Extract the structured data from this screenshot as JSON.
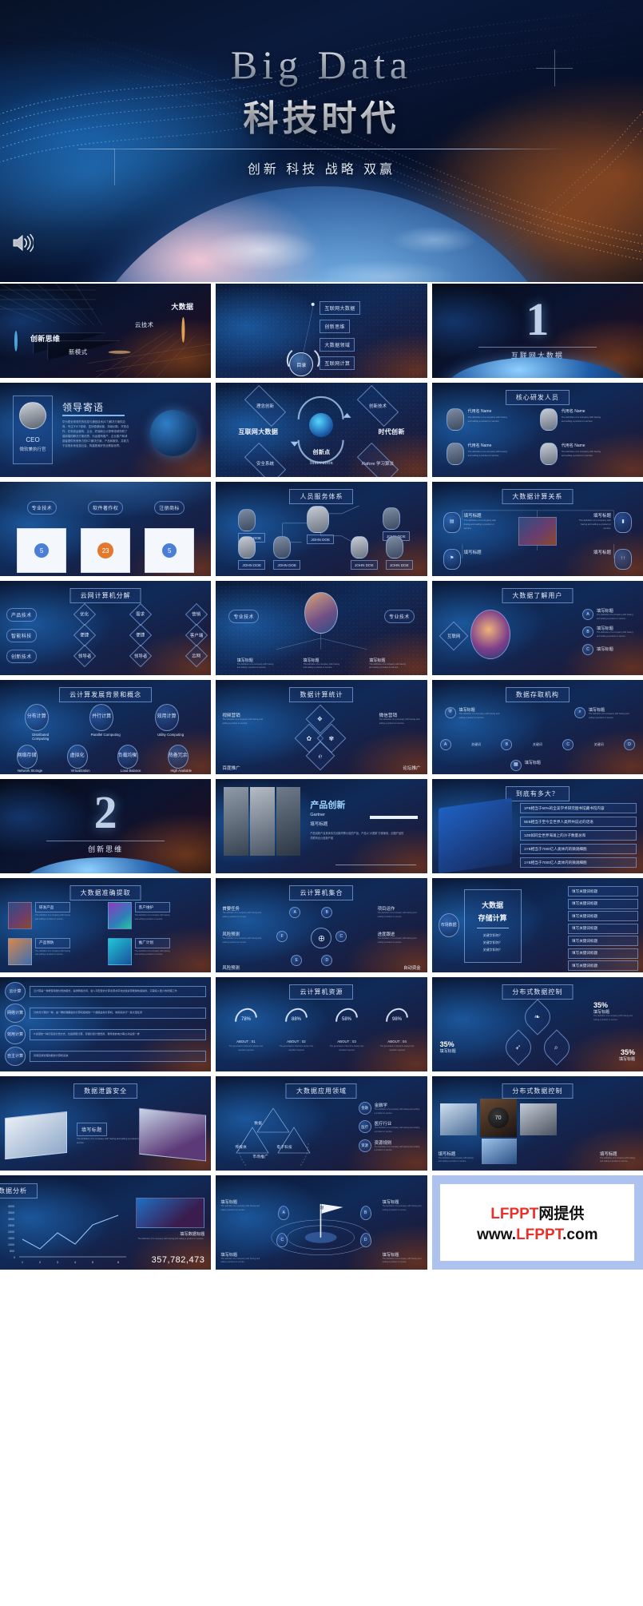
{
  "hero": {
    "title_en": "Big Data",
    "title_cn": "科技时代",
    "subtitle": "创新  科技  战略  双赢",
    "speaker_icon": "speaker-icon"
  },
  "watermark": {
    "line1_red": "LFPPT",
    "line1_black": "网提供",
    "line2_black": "www.",
    "line2_red": "LFPPT",
    "line2_black_end": ".com"
  },
  "slides": [
    {
      "id": 1,
      "name": "intro-keywords",
      "style": "dark",
      "title": "",
      "labels": [
        "大数据",
        "云技术",
        "创新思维",
        "新模式"
      ]
    },
    {
      "id": 2,
      "name": "table-of-contents",
      "style": "blue",
      "title": "",
      "center_label": "目录",
      "chips": [
        "互联网大数据",
        "创新思维",
        "大数据领域",
        "互联网计算"
      ]
    },
    {
      "id": 3,
      "name": "section-one-cover",
      "style": "dark",
      "title": "",
      "number": "1",
      "number_label": "互联网大数据"
    },
    {
      "id": 4,
      "name": "leader-message",
      "style": "blue",
      "title": "",
      "heading": "领导寄语",
      "role": "CEO",
      "role_sub": "微软兼执行官",
      "paragraph": "华为是全球领先的信息与通信技术(ICT)解决方案供应商，专注于ICT领域，坚持稳健经营、持续创新、开放合作，在电信运营商、企业、终端和云计算等领域构筑了端到端的解决方案优势，为运营商客户、企业客户和消费者提供有竞争力的ICT解决方案、产品和服务，并致力于实现未来信息社会、构建更美好的全联接世界。"
    },
    {
      "id": 5,
      "name": "innovation-loop",
      "style": "blue",
      "title": "",
      "center_big": "创新点",
      "center_sub": "Innovation",
      "nodes": [
        "理念创新",
        "创新技术",
        "互联网大数据",
        "时代创新",
        "安全系统",
        "Rafore 学习算法"
      ]
    },
    {
      "id": 6,
      "name": "core-rd-team",
      "style": "blue",
      "title": "核心研发人员",
      "members": [
        {
          "name": "代用名 Name",
          "desc": "The definition of a company with having and selling a product or service."
        },
        {
          "name": "代用名 Name",
          "desc": "The definition of a company with having and selling a product or service."
        },
        {
          "name": "代用名 Name",
          "desc": "The definition of a company with having and selling a product or service."
        },
        {
          "name": "代用名 Name",
          "desc": "The definition of a company with having and selling a product or service."
        }
      ]
    },
    {
      "id": 7,
      "name": "certificates",
      "style": "blue",
      "title": "",
      "clouds": [
        "专业技术",
        "软件著作权",
        "注册商标"
      ],
      "badges": [
        "5",
        "23",
        "5"
      ]
    },
    {
      "id": 8,
      "name": "personnel-service-system",
      "style": "blue",
      "title": "人员服务体系",
      "tags": [
        "JOHN DOE",
        "JOHN DOE",
        "JOHN DOE",
        "JOHN DOE",
        "JOHN DOE",
        "JOHN DOE",
        "JOHN DOE",
        "JOHN DOE"
      ]
    },
    {
      "id": 9,
      "name": "bigdata-compute-relation",
      "style": "blue",
      "title": "大数据计算关系",
      "items": [
        {
          "label": "填写标题",
          "desc": "The definition of a company with having and selling a product or service."
        },
        {
          "label": "填写标题",
          "desc": "The definition of a company with having and selling a product or service."
        },
        {
          "label": "填写标题",
          "desc": "The definition of a company with having and selling a product or service."
        },
        {
          "label": "填写标题",
          "desc": "The definition of a company with having and selling a product or service."
        }
      ]
    },
    {
      "id": 10,
      "name": "cloud-computer-decompose",
      "style": "blue",
      "title": "云网计算机分解",
      "rows": [
        [
          "产品技术",
          "优化",
          "需求",
          "营销"
        ],
        [
          "智能科技",
          "便捷",
          "便捷",
          "客户端"
        ],
        [
          "创新技术",
          "领导者",
          "领导者",
          "云网"
        ]
      ]
    },
    {
      "id": 11,
      "name": "professional-skills",
      "style": "blue",
      "title": "",
      "clouds": [
        "专业技术",
        "专业技术"
      ],
      "captions": [
        "填写标题",
        "填写标题",
        "填写标题"
      ],
      "desc": "The definition of a company with having and selling a product or service."
    },
    {
      "id": 12,
      "name": "bigdata-understand-user",
      "style": "blue",
      "title": "大数据了解用户",
      "left_label": "互联网",
      "items": [
        {
          "key": "A",
          "label": "填写标题",
          "desc": "The definition of a company with having and selling a product or service."
        },
        {
          "key": "B",
          "label": "填写标题",
          "desc": "The definition of a company with having and selling a product or service."
        },
        {
          "key": "C",
          "label": "填写标题",
          "desc": "The definition of a company with having and selling a product or service."
        }
      ]
    },
    {
      "id": 13,
      "name": "cloud-computing-background",
      "style": "blue",
      "title": "云计算发展背景和概念",
      "row1_cn": [
        "分布计算",
        "并行计算",
        "效用计算"
      ],
      "row1_en": [
        "Distributed Computing",
        "Parallel Computing",
        "Utility Computing"
      ],
      "row2_cn": [
        "网络存储",
        "虚拟化",
        "负载均衡",
        "热备冗余"
      ],
      "row2_en": [
        "Network Storage",
        "Virtualization",
        "Load Balance",
        "High Available"
      ]
    },
    {
      "id": 14,
      "name": "data-compute-statistics",
      "style": "blue",
      "title": "数据计算统计",
      "labels": [
        "视频营销",
        "微信营销",
        "百度推广",
        "论坛推广"
      ],
      "desc": "The definition of a company with having and selling a product or service."
    },
    {
      "id": 15,
      "name": "data-access-organization",
      "style": "blue",
      "title": "数据存取机构",
      "steps": [
        "A",
        "B",
        "C",
        "D"
      ],
      "connectors": [
        "关键词",
        "关键词",
        "关键词"
      ],
      "items": [
        {
          "label": "填写标题",
          "desc": "The definition of a company with having and selling a product or service."
        },
        {
          "label": "填写标题",
          "desc": "The definition of a company with having and selling a product or service."
        },
        {
          "label": "填写标题",
          "desc": "The definition of a company with having and selling a product or service."
        }
      ]
    },
    {
      "id": 16,
      "name": "section-two-cover",
      "style": "dark",
      "title": "",
      "number": "2",
      "number_label": "创新思维"
    },
    {
      "id": 17,
      "name": "product-innovation",
      "style": "blue",
      "title": "",
      "heading": "产品创新",
      "sub1": "Gartner",
      "sub2": "填写标题",
      "paragraph": "产品创新户及其体系式创新同等价值的产品，产品以\"大更新\"方便使用，创造产品的关联商业价值新产链"
    },
    {
      "id": 18,
      "name": "how-big-is-it",
      "style": "blue",
      "title": "到底有多大？",
      "facts": [
        "1PB相当于50%的全美学术研究图书馆藏书馆内容",
        "5EB相当于至今全世界人类所共说过的话语",
        "1ZB如同全世界海滩上的沙子数量总和",
        "1YB相当于7000亿人类体内的微观细胞",
        "1YB相当于7000亿人类体内的微观细胞"
      ]
    },
    {
      "id": 19,
      "name": "bigdata-accurate-extract",
      "style": "blue",
      "title": "大数据准确提取",
      "cards": [
        {
          "label": "研发产品",
          "desc": "The definition of a company with having and selling a product or service."
        },
        {
          "label": "客户维护",
          "desc": "The definition of a company with having and selling a product or service."
        },
        {
          "label": "产品预防",
          "desc": "The definition of a company with having and selling a product or service."
        },
        {
          "label": "推广计划",
          "desc": "The definition of a company with having and selling a product or service."
        }
      ]
    },
    {
      "id": 20,
      "name": "cloud-computer-aggregation",
      "style": "blue",
      "title": "云计算机集合",
      "keys": [
        "A",
        "B",
        "F",
        "C",
        "E",
        "D"
      ],
      "labels": [
        "首要任务",
        "项目运作",
        "风险预测",
        "进度跟进",
        "风险预测",
        "自动资金"
      ],
      "desc": "The definition of a company with having and selling a product or service."
    },
    {
      "id": 21,
      "name": "bigdata-storage-compute",
      "style": "blue",
      "title": "",
      "center_l1": "大数据",
      "center_l2": "存储计算",
      "left_label": "市场数据",
      "questions": [
        "关键字如何？",
        "关键字如何？",
        "关键字如何？"
      ],
      "bullets": [
        "填写关键词标题",
        "填写关键词标题",
        "填写关键词标题",
        "填写关键词标题",
        "填写关键词标题",
        "填写关键词标题",
        "填写关键词标题"
      ]
    },
    {
      "id": 22,
      "name": "computing-types-list",
      "style": "blue",
      "title": "",
      "items": [
        {
          "label": "云计算",
          "desc": "云计算是一种按使用量付费的模式，提供网络访问，进入可配置的计算资源共享池这些资源能够快速提供，只需投入很少的管理工作"
        },
        {
          "label": "网络计算",
          "desc": "分布式计算的一种，由一群松散耦合的计算机组成的一个超级虚拟计算机，常用来执行一些大型任务"
        },
        {
          "label": "效用计算",
          "desc": "IT资源的一种打包和计费方式，比如按照计算、存储分别计量费用，像传统的电力等公共设施一样"
        },
        {
          "label": "自主计算",
          "desc": "具有自我管理功能的计算机系统"
        }
      ]
    },
    {
      "id": 23,
      "name": "cloud-computer-resources",
      "style": "blue",
      "title": "云计算机资源",
      "percents": [
        "78%",
        "88%",
        "58%",
        "98%"
      ],
      "captions": [
        "ABOUT : 01",
        "ABOUT : 02",
        "ABOUT : 03",
        "ABOUT : 04"
      ],
      "desc": "The generated is therefore always has repetition injected"
    },
    {
      "id": 24,
      "name": "distributed-data-control",
      "style": "blue",
      "title": "分布式数据控制",
      "stats": [
        "35%",
        "35%",
        "35%",
        "35%"
      ],
      "labels": [
        "填写标题",
        "填写标题",
        "填写标题",
        "填写标题"
      ],
      "desc": "The definition of a company with having and selling a product or service."
    },
    {
      "id": 25,
      "name": "data-leak-security",
      "style": "blue",
      "title": "数据泄露安全",
      "label": "填写标题",
      "desc": "The definition of a company with having and selling a product or service."
    },
    {
      "id": 26,
      "name": "bigdata-application-fields",
      "style": "blue",
      "title": "大数据应用领域",
      "triangle_labels": [
        "市场推广",
        "数据",
        "传媒体",
        "电子科技"
      ],
      "side_items": [
        {
          "key": "金融",
          "label": "金融学",
          "desc": "The definition of a company with having and selling a product or service."
        },
        {
          "key": "医疗",
          "label": "医疗行业",
          "desc": "The definition of a company with having and selling a product or service."
        },
        {
          "key": "资源",
          "label": "资源规则",
          "desc": "The definition of a company with having and selling a product or service."
        }
      ]
    },
    {
      "id": 27,
      "name": "distributed-data-control-b",
      "style": "blue",
      "title": "分布式数据控制",
      "gauge": "70",
      "items": [
        {
          "label": "填写标题",
          "desc": "The definition of a company with having and selling a product or service."
        },
        {
          "label": "填写标题",
          "desc": "The definition of a company with having and selling a product or service."
        }
      ]
    },
    {
      "id": 28,
      "name": "data-analysis",
      "style": "blue",
      "title": "数据分析",
      "caption": "填写数据标题",
      "desc": "The definition of a company with having and selling a product or service.",
      "big_number": "357,782,473",
      "chart_data": {
        "type": "line",
        "title": "数据分析",
        "x": [
          1,
          2,
          3,
          4,
          5,
          6
        ],
        "values": [
          1400,
          900,
          1750,
          1150,
          2100,
          2850
        ],
        "xlabel": "",
        "ylabel": "",
        "ylim": [
          0,
          4000
        ],
        "yticks": [
          0,
          500,
          1000,
          1500,
          2000,
          2500,
          3000,
          3500,
          4000
        ],
        "xticks": [
          "1",
          "2",
          "3",
          "4",
          "5",
          "6"
        ],
        "grid": false,
        "legend": "none"
      }
    },
    {
      "id": 29,
      "name": "target-radar",
      "style": "blue",
      "title": "",
      "flag_label": "标题",
      "points": [
        {
          "key": "A",
          "label": "填写标题",
          "desc": "The definition of a company with having and selling a product or service."
        },
        {
          "key": "B",
          "label": "填写标题",
          "desc": "The definition of a company with having and selling a product or service."
        },
        {
          "key": "C",
          "label": "填写标题",
          "desc": "The definition of a company with having and selling a product or service."
        },
        {
          "key": "D",
          "label": "填写标题",
          "desc": "The definition of a company with having and selling a product or service."
        }
      ]
    }
  ]
}
